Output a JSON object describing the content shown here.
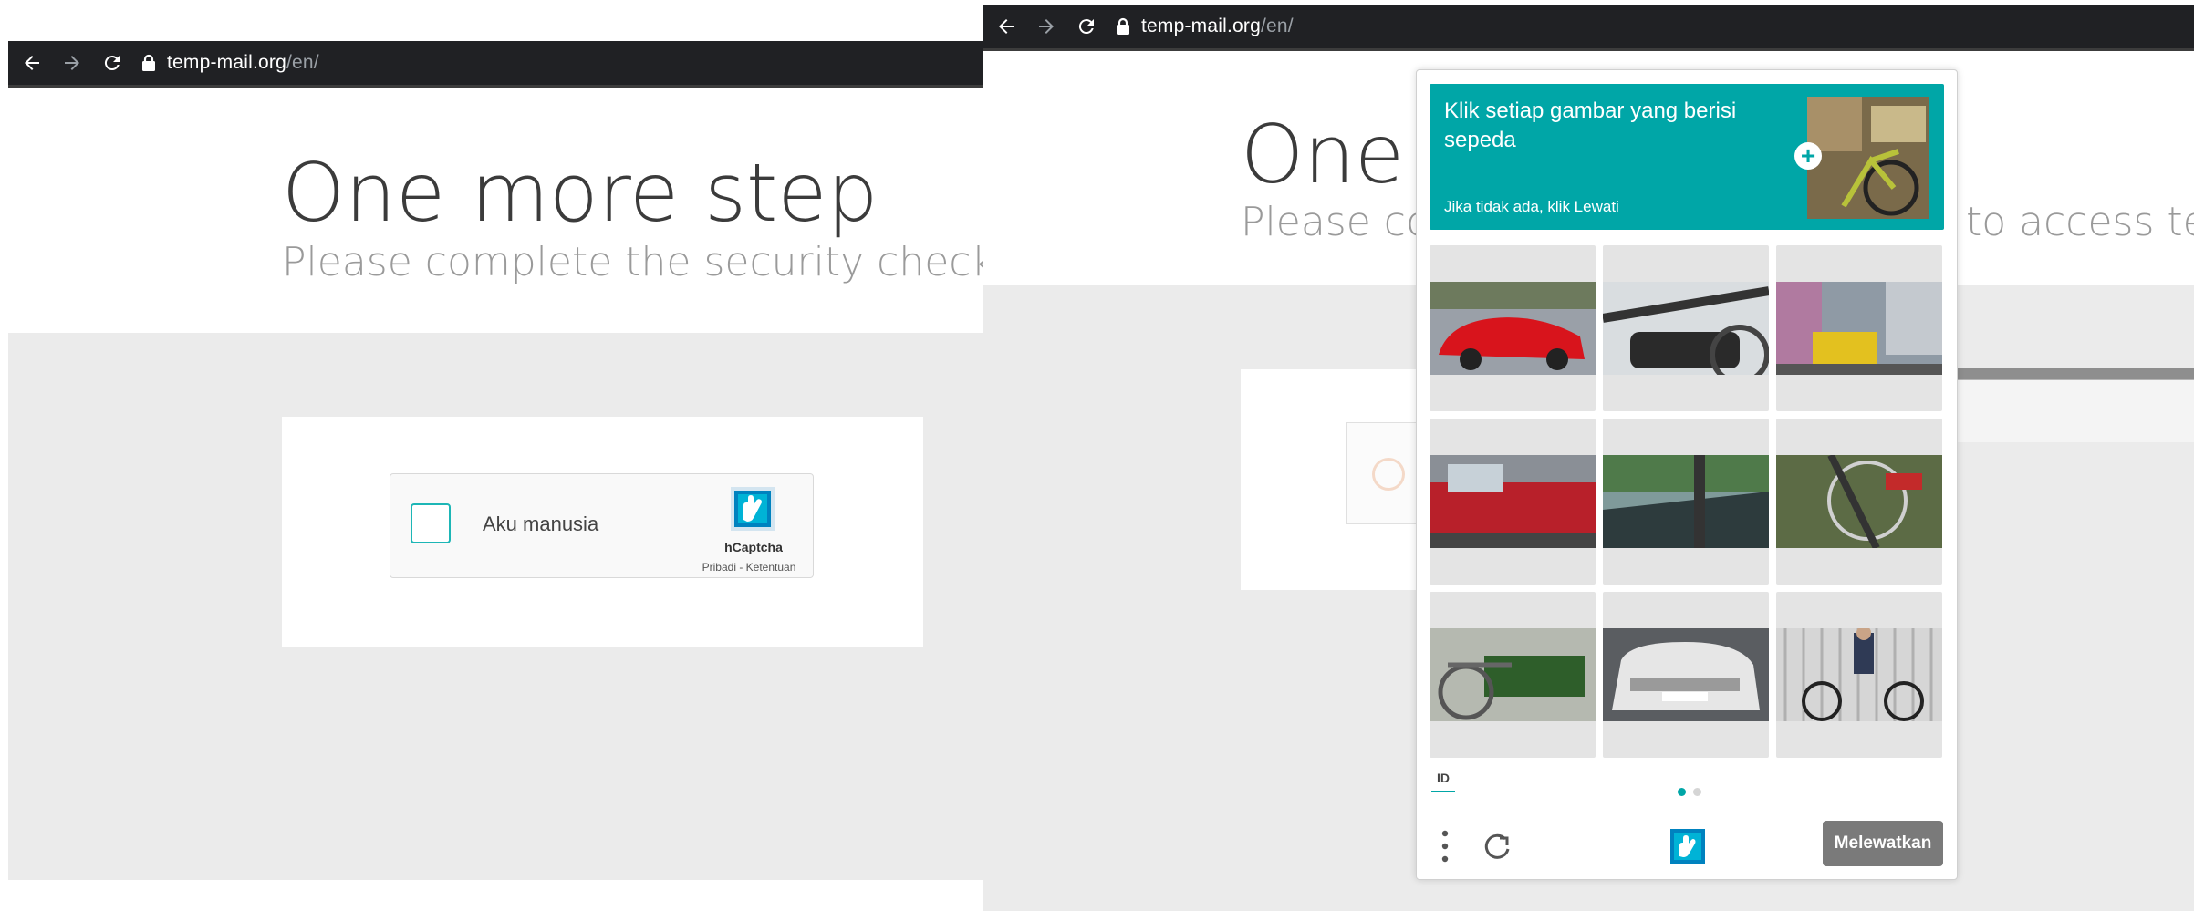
{
  "left": {
    "browser": {
      "host": "temp-mail.org",
      "path": "/en/"
    },
    "page": {
      "headline": "One more step",
      "subline": "Please complete the security check to access temp-mail.org"
    },
    "hcaptcha": {
      "checkbox_label": "Aku manusia",
      "brand": "hCaptcha",
      "privacy": "Pribadi",
      "separator": " - ",
      "terms": "Ketentuan"
    }
  },
  "right": {
    "browser": {
      "host": "temp-mail.org",
      "path": "/en/"
    },
    "page": {
      "headline": "One more step",
      "subline": "Please complete the security check to access temp-mail.org"
    },
    "challenge": {
      "prompt": "Klik setiap gambar yang berisi sepeda",
      "hint": "Jika tidak ada, klik Lewati",
      "example_icon": "plus-icon",
      "tiles": [
        {
          "subject": "red sports car"
        },
        {
          "subject": "bicycle handlebar close-up"
        },
        {
          "subject": "city street with bus"
        },
        {
          "subject": "red vehicle side"
        },
        {
          "subject": "car hood through windshield"
        },
        {
          "subject": "bicycle wheel close-up"
        },
        {
          "subject": "green bicycle basket"
        },
        {
          "subject": "white car rear"
        },
        {
          "subject": "man riding bicycle"
        }
      ],
      "language": "ID",
      "page_count": 2,
      "current_page": 1,
      "skip_label": "Melewatkan",
      "icons": [
        "more-vertical-icon",
        "refresh-icon",
        "hcaptcha-logo-icon"
      ]
    }
  },
  "colors": {
    "accent": "#00a6a7",
    "browser_bar": "#202124",
    "skip_button": "#7a7a7a",
    "page_gray": "#ebebeb"
  }
}
